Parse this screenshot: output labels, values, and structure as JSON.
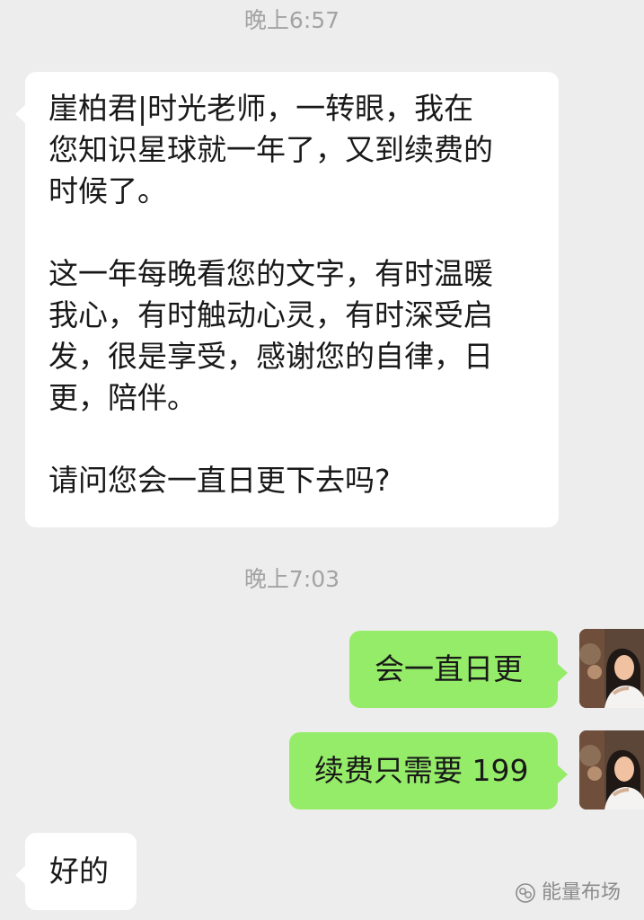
{
  "timestamps": {
    "first": "晚上6:57",
    "second": "晚上7:03"
  },
  "messages": {
    "incoming_1": {
      "lines": [
        "崖柏君|时光老师，一转眼，我在",
        "您知识星球就一年了，又到续费的",
        "时候了。",
        "这一年每晚看您的文字，有时温暖",
        "我心，有时触动心灵，有时深受启",
        "发，很是享受，感谢您的自律，日",
        "更，陪伴。",
        "请问您会一直日更下去吗?"
      ]
    },
    "outgoing_1": {
      "text": "会一直日更"
    },
    "outgoing_2": {
      "text": "续费只需要 199"
    },
    "incoming_2": {
      "text": "好的"
    }
  },
  "watermark": {
    "text": "能量布场",
    "icon": "wechat-official-account-icon"
  },
  "colors": {
    "background": "#ededed",
    "incoming_bubble": "#ffffff",
    "outgoing_bubble": "#95ec69",
    "timestamp_text": "#a3a3a3",
    "message_text": "#191919"
  }
}
